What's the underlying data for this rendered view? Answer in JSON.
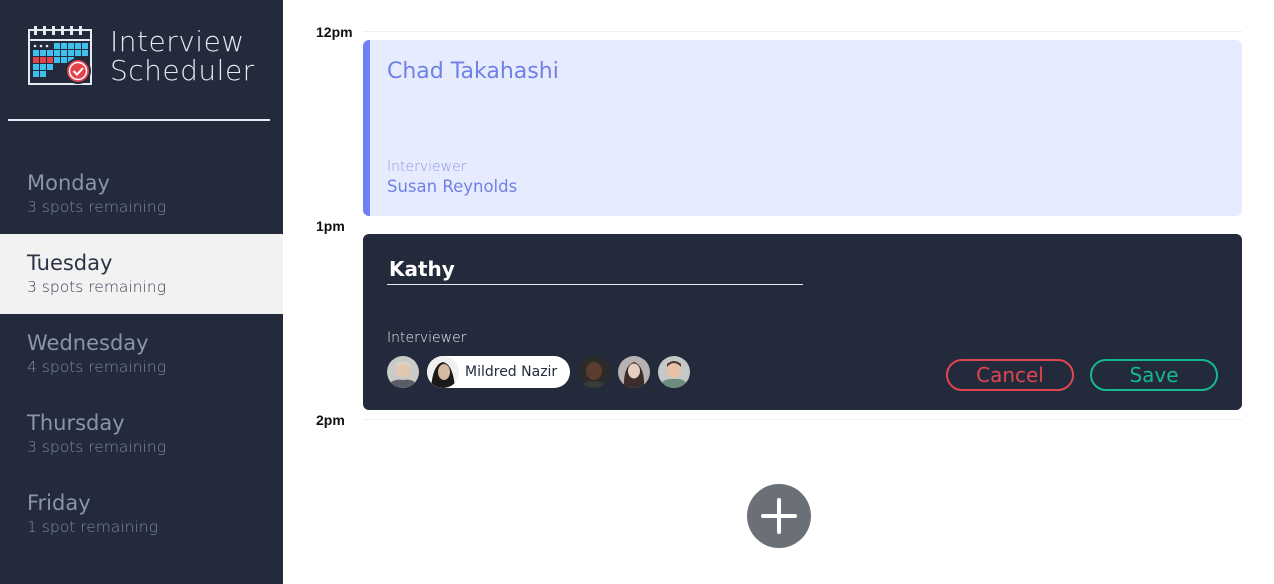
{
  "brand": {
    "line1": "Interview",
    "line2": "Scheduler"
  },
  "days": [
    {
      "name": "Monday",
      "spots": "3 spots remaining",
      "selected": false
    },
    {
      "name": "Tuesday",
      "spots": "3 spots remaining",
      "selected": true
    },
    {
      "name": "Wednesday",
      "spots": "4 spots remaining",
      "selected": false
    },
    {
      "name": "Thursday",
      "spots": "3 spots remaining",
      "selected": false
    },
    {
      "name": "Friday",
      "spots": "1 spot remaining",
      "selected": false
    }
  ],
  "schedule": {
    "times": [
      "12pm",
      "1pm",
      "2pm"
    ],
    "appointment": {
      "student": "Chad Takahashi",
      "interviewer_label": "Interviewer",
      "interviewer_name": "Susan Reynolds"
    },
    "form": {
      "student_value": "Kathy",
      "interviewer_label": "Interviewer",
      "selected_interviewer": "Mildred Nazir",
      "cancel_label": "Cancel",
      "save_label": "Save"
    }
  },
  "icons": {
    "logo": "calendar-check-icon",
    "add": "plus-icon"
  },
  "colors": {
    "sidebar_bg": "#222a3c",
    "accent": "#6f80f5",
    "danger": "#e0464f",
    "success": "#18b88f"
  }
}
